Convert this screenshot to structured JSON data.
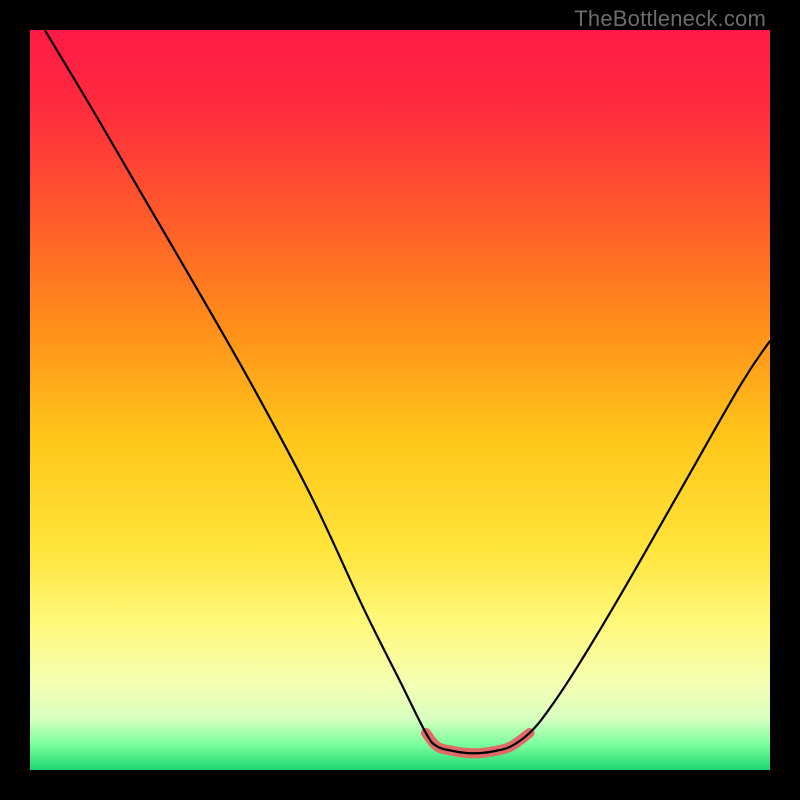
{
  "watermark": "TheBottleneck.com",
  "gradient": {
    "stops": [
      {
        "offset": 0.0,
        "color": "#ff1a46"
      },
      {
        "offset": 0.1,
        "color": "#ff2a3e"
      },
      {
        "offset": 0.25,
        "color": "#ff5a2a"
      },
      {
        "offset": 0.4,
        "color": "#ff8e1a"
      },
      {
        "offset": 0.55,
        "color": "#ffc61a"
      },
      {
        "offset": 0.7,
        "color": "#ffe43a"
      },
      {
        "offset": 0.8,
        "color": "#fff87a"
      },
      {
        "offset": 0.88,
        "color": "#f6ffb0"
      },
      {
        "offset": 0.93,
        "color": "#d8ffc0"
      },
      {
        "offset": 0.965,
        "color": "#7cff9c"
      },
      {
        "offset": 1.0,
        "color": "#1cd872"
      }
    ]
  },
  "chart_data": {
    "type": "line",
    "title": "",
    "xlabel": "",
    "ylabel": "",
    "xlim": [
      0,
      100
    ],
    "ylim": [
      0,
      100
    ],
    "series": [
      {
        "name": "main-curve",
        "color": "#000000",
        "width": 2.2,
        "x": [
          2,
          8,
          15,
          22,
          30,
          38,
          45,
          50,
          53.5,
          55,
          57,
          59,
          61,
          63,
          65,
          67.5,
          70,
          74,
          80,
          88,
          96,
          100
        ],
        "y": [
          100,
          90,
          78,
          66,
          52,
          37,
          22,
          12,
          5,
          3.2,
          2.6,
          2.3,
          2.3,
          2.6,
          3.2,
          5,
          8,
          14,
          24,
          38,
          52,
          58
        ]
      },
      {
        "name": "highlight-segment",
        "color": "#e06a66",
        "width": 10,
        "linecap": "round",
        "x": [
          53.5,
          55,
          57,
          59,
          61,
          63,
          65,
          67.5
        ],
        "y": [
          5,
          3.2,
          2.6,
          2.3,
          2.3,
          2.6,
          3.2,
          5
        ]
      }
    ]
  }
}
